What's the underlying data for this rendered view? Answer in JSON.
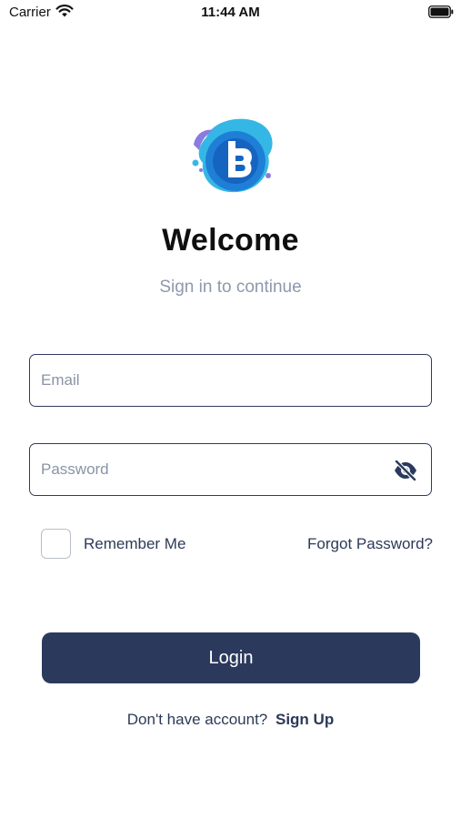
{
  "status_bar": {
    "carrier": "Carrier",
    "time": "11:44 AM"
  },
  "colors": {
    "primary": "#2b3a5c",
    "logo_blue": "#1f7fd6",
    "logo_light": "#35b7e6",
    "subtitle": "#8e98ad"
  },
  "icons": {
    "wifi": "wifi-icon",
    "battery": "battery-icon",
    "logo": "b-logo",
    "password_visibility": "eye-slash-icon"
  },
  "header": {
    "title": "Welcome",
    "subtitle": "Sign in to continue"
  },
  "form": {
    "email_placeholder": "Email",
    "email_value": "",
    "password_placeholder": "Password",
    "password_value": "",
    "remember_label": "Remember Me",
    "remember_checked": false,
    "forgot_label": "Forgot Password?",
    "login_label": "Login"
  },
  "footer": {
    "prompt": "Don't have account?",
    "signup_label": "Sign Up"
  }
}
